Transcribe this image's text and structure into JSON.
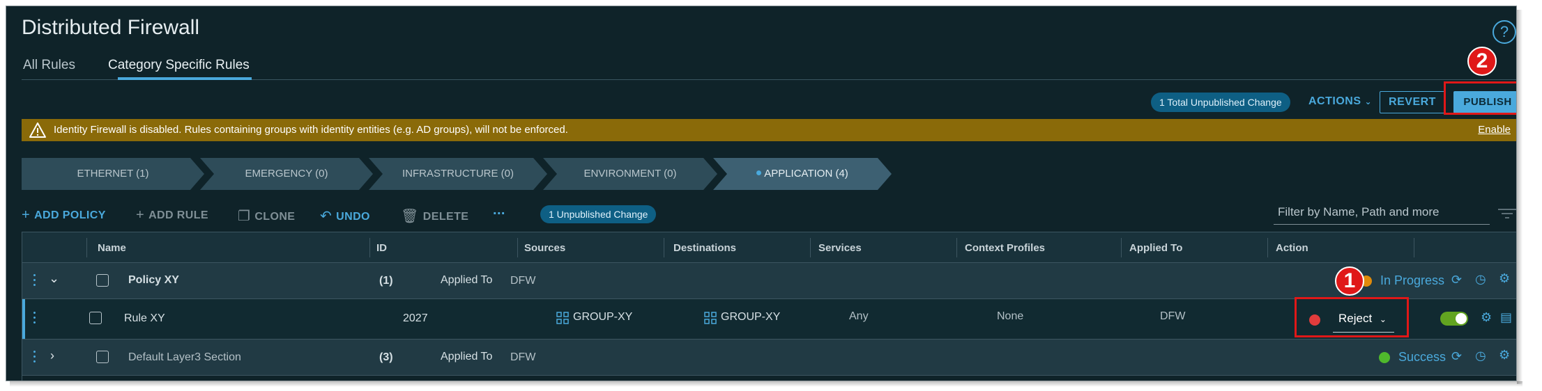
{
  "page": {
    "title": "Distributed Firewall",
    "help_icon": "help-circle-icon",
    "tabs": [
      {
        "label": "All Rules",
        "active": false
      },
      {
        "label": "Category Specific Rules",
        "active": true
      }
    ]
  },
  "header_actions": {
    "unpublished_badge": "1 Total Unpublished Change",
    "actions_label": "ACTIONS",
    "revert_label": "REVERT",
    "publish_label": "PUBLISH"
  },
  "banner": {
    "message": "Identity Firewall is disabled. Rules containing groups with identity entities (e.g. AD groups), will not be enforced.",
    "link": "Enable",
    "icon": "warning-triangle-icon",
    "color": "#8a6a09"
  },
  "categories": [
    {
      "label": "ETHERNET (1)",
      "active": false
    },
    {
      "label": "EMERGENCY (0)",
      "active": false
    },
    {
      "label": "INFRASTRUCTURE (0)",
      "active": false
    },
    {
      "label": "ENVIRONMENT (0)",
      "active": false
    },
    {
      "label": "APPLICATION (4)",
      "active": true
    }
  ],
  "toolbar": {
    "add_policy": "ADD POLICY",
    "add_rule": "ADD RULE",
    "clone": "CLONE",
    "undo": "UNDO",
    "delete": "DELETE",
    "more": "...",
    "unpublished_badge": "1 Unpublished Change",
    "filter_placeholder": "Filter by Name, Path and more"
  },
  "table": {
    "columns": [
      "Name",
      "ID",
      "Sources",
      "Destinations",
      "Services",
      "Context Profiles",
      "Applied To",
      "Action"
    ],
    "policies": [
      {
        "name": "Policy XY",
        "count": "(1)",
        "applied_to_label": "Applied To",
        "applied_to": "DFW",
        "status": "In Progress",
        "status_color": "#e08a0b",
        "expanded": true
      },
      {
        "name": "Default Layer3 Section",
        "count": "(3)",
        "applied_to_label": "Applied To",
        "applied_to": "DFW",
        "status": "Success",
        "status_color": "#4fb82c",
        "expanded": false
      }
    ],
    "rule": {
      "name": "Rule XY",
      "id": "2027",
      "source": "GROUP-XY",
      "destination": "GROUP-XY",
      "service": "Any",
      "context_profile": "None",
      "applied_to": "DFW",
      "action": "Reject",
      "action_color": "#e23c3c",
      "enabled": true
    }
  },
  "callouts": [
    {
      "number": "1"
    },
    {
      "number": "2"
    }
  ],
  "colors": {
    "background": "#0f2329",
    "accent": "#4aa9dc",
    "callout": "#e01818"
  }
}
